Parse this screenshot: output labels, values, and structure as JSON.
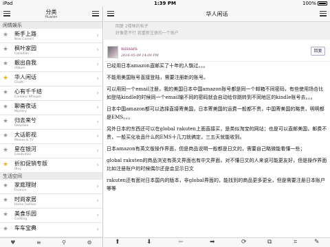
{
  "status": {
    "carrier": "iPad",
    "time": "1:39 PM",
    "battery": "100%"
  },
  "left": {
    "title": "分类",
    "subtitle": "Huaren",
    "sections": [
      {
        "header": "闲情娱乐",
        "items": [
          {
            "name": "新手上路",
            "en": "New Comers",
            "starred": false
          },
          {
            "name": "枫叶家园",
            "en": "Canadian",
            "starred": false
          },
          {
            "name": "靓出自我",
            "en": "iAlbum",
            "starred": false
          },
          {
            "name": "华人闲话",
            "en": "Chats",
            "starred": true
          },
          {
            "name": "心有千千结",
            "en": "Careless Whisper",
            "starred": false
          },
          {
            "name": "聊斋夜话",
            "en": "Mystery",
            "starred": false
          },
          {
            "name": "归去来兮",
            "en": "Returnee",
            "starred": false
          },
          {
            "name": "大话影视",
            "en": "Movies & TV",
            "starred": false
          },
          {
            "name": "星在银河",
            "en": "Celebrities",
            "starred": false
          },
          {
            "name": "折扣促销专版",
            "en": "iBuy",
            "starred": true
          }
        ]
      },
      {
        "header": "生活空间",
        "items": [
          {
            "name": "家庭理财",
            "en": "Finance",
            "starred": false
          },
          {
            "name": "时尚家居",
            "en": "Home Fashion",
            "starred": false
          },
          {
            "name": "美食乐园",
            "en": "Cooking",
            "starred": false
          },
          {
            "name": "车车宝典",
            "en": "",
            "starred": false
          }
        ]
      }
    ],
    "toolbar": {
      "fav": "♥",
      "list": "≡",
      "search": "⚲",
      "settings": "⚙"
    }
  },
  "right": {
    "title": "华人闲话",
    "quote": [
      "回复 2楼咪的帖子",
      "好像是不行 我重新注册的一个账户"
    ],
    "post": {
      "author": "missara",
      "date": "2016-05-09 14:00 PM",
      "reply": "回复",
      "paragraphs": [
        "已经用日本amazon直邮买了十年的人飘过。。。",
        "不能用美国账号直接登陆，需要注册新的账号。",
        "可以用同一个email注册，我的美国日本中国amazon账号都是同一个邮箱不同密码，有些使用场合比如登陆kindle的时候同一个email输不同的密码就会自动给你跳转到不同地区的kindle账号去。。。",
        "日本中国amazon都可以选择直接寄美国，日本寄美国的运费一般都不贵，中国寄美国的略贵，明明都是EMS。。。",
        "另外日本的东西还可以在global rakuten上面直接买，是类似淘宝的网站；也是可以直邮美国，邮费不贵，一般买化妆品什么的EMS十几刀就搞定，三五天就能收到。",
        "日本amazon有英文版操作界面，但是商品说明一般都是日文的，需要自己略微能看懂一些；",
        "global rakuten的商品浏览有英文界面也有中文界面，对不懂日文的人来说可能更友好，但是操作界面比如注册账户的时候偶尔还是会显示日文",
        "rakuten还有面对日本国内的版本，非global界面的，能找到的商品更多更全，但是需要注册日本账户等等"
      ]
    },
    "toolbar": [
      "⬆",
      "⬇",
      "⬅",
      "➡",
      "⟳",
      "⧉",
      "⌗",
      "✎"
    ]
  }
}
